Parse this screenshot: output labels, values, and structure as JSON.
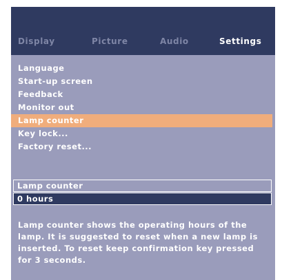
{
  "colors": {
    "header_bg": "#2f3a60",
    "panel_bg": "#9a9cbb",
    "highlight": "#f0ad7c",
    "inactive_tab": "#7f86a6",
    "text": "#ffffff"
  },
  "tabs": [
    {
      "label": "Display",
      "active": false
    },
    {
      "label": "Picture",
      "active": false
    },
    {
      "label": "Audio",
      "active": false
    },
    {
      "label": "Settings",
      "active": true
    }
  ],
  "menu": {
    "items": [
      {
        "label": "Language"
      },
      {
        "label": "Start-up screen"
      },
      {
        "label": "Feedback"
      },
      {
        "label": "Monitor out"
      },
      {
        "label": "Lamp counter",
        "selected": true
      },
      {
        "label": "Key lock..."
      },
      {
        "label": "Factory reset..."
      }
    ]
  },
  "info": {
    "title": "Lamp counter",
    "value": "0 hours"
  },
  "help": {
    "text": "Lamp counter shows the operating hours of the lamp. It is suggested to reset when a new lamp is inserted. To reset keep confirmation key pressed for 3 seconds."
  }
}
